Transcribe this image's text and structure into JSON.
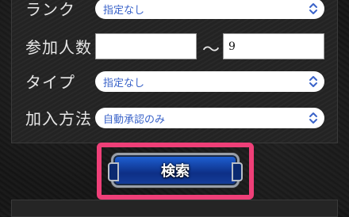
{
  "form": {
    "rank_label": "ランク",
    "rank_value": "指定なし",
    "participants_label": "参加人数",
    "participants_min": "",
    "participants_separator": "〜",
    "participants_max": "9",
    "type_label": "タイプ",
    "type_value": "指定なし",
    "join_label": "加入方法",
    "join_value": "自動承認のみ"
  },
  "actions": {
    "search_label": "検索"
  },
  "colors": {
    "select_text": "#3a63c9",
    "highlight": "#ef3f78",
    "button_blue": "#1f63d8"
  },
  "icons": {
    "select_chevron": "chevron-up-down-icon"
  }
}
